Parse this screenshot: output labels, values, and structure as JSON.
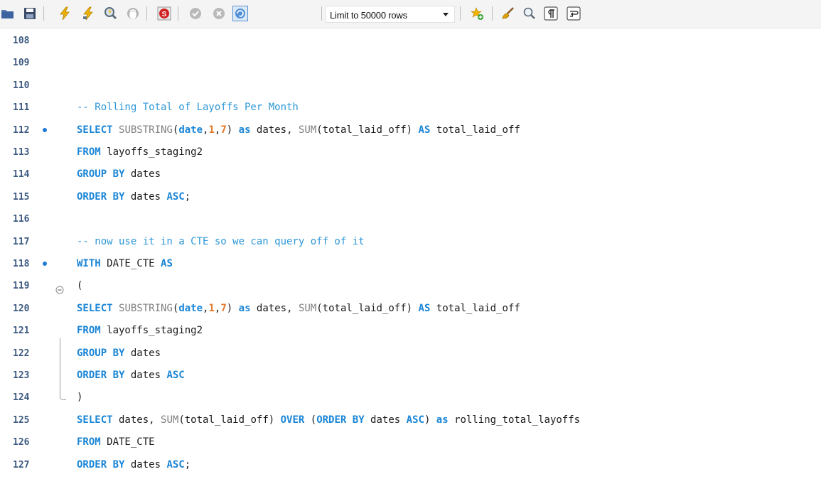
{
  "toolbar": {
    "buttons": [
      {
        "name": "open-folder-icon",
        "color": "#4a6fa5"
      },
      {
        "name": "save-icon",
        "color": "#3a4a66"
      },
      {
        "name": "execute-lightning-icon",
        "color": "#f0b400"
      },
      {
        "name": "execute-current-lightning-icon",
        "color": "#f0b400"
      },
      {
        "name": "explain-magnifier-icon",
        "color": "#6a7a8a"
      },
      {
        "name": "stop-icon",
        "color": "#9a9a9a"
      },
      {
        "name": "stop-on-error-icon",
        "color": "#d02020"
      },
      {
        "name": "commit-icon",
        "color": "#9a9a9a"
      },
      {
        "name": "rollback-icon",
        "color": "#9a9a9a"
      },
      {
        "name": "autocommit-icon",
        "color": "#2f78c8"
      },
      {
        "name": "add-snippet-star-icon",
        "color": "#f0b400"
      },
      {
        "name": "beautify-brush-icon",
        "color": "#e0a000"
      },
      {
        "name": "find-magnifier-icon",
        "color": "#6a7a8a"
      },
      {
        "name": "invisible-chars-icon",
        "color": "#333333"
      },
      {
        "name": "word-wrap-icon",
        "color": "#333333"
      }
    ],
    "limit_label": "Limit to 50000 rows"
  },
  "editor": {
    "lines": [
      {
        "n": "108",
        "bp": false,
        "tokens": []
      },
      {
        "n": "109",
        "bp": false,
        "tokens": []
      },
      {
        "n": "110",
        "bp": false,
        "tokens": []
      },
      {
        "n": "111",
        "bp": false,
        "tokens": [
          {
            "t": "cm",
            "v": "-- Rolling Total of Layoffs Per Month"
          }
        ]
      },
      {
        "n": "112",
        "bp": true,
        "tokens": [
          {
            "t": "kw",
            "v": "SELECT"
          },
          {
            "t": "tx",
            "v": " "
          },
          {
            "t": "fn",
            "v": "SUBSTRING"
          },
          {
            "t": "tx",
            "v": "("
          },
          {
            "t": "kw",
            "v": "date"
          },
          {
            "t": "tx",
            "v": ","
          },
          {
            "t": "num",
            "v": "1"
          },
          {
            "t": "tx",
            "v": ","
          },
          {
            "t": "num",
            "v": "7"
          },
          {
            "t": "tx",
            "v": ") "
          },
          {
            "t": "kw",
            "v": "as"
          },
          {
            "t": "tx",
            "v": " dates, "
          },
          {
            "t": "fn",
            "v": "SUM"
          },
          {
            "t": "tx",
            "v": "(total_laid_off) "
          },
          {
            "t": "kw",
            "v": "AS"
          },
          {
            "t": "tx",
            "v": " total_laid_off"
          }
        ]
      },
      {
        "n": "113",
        "bp": false,
        "tokens": [
          {
            "t": "kw",
            "v": "FROM"
          },
          {
            "t": "tx",
            "v": " layoffs_staging2"
          }
        ]
      },
      {
        "n": "114",
        "bp": false,
        "tokens": [
          {
            "t": "kw",
            "v": "GROUP BY"
          },
          {
            "t": "tx",
            "v": " dates"
          }
        ]
      },
      {
        "n": "115",
        "bp": false,
        "tokens": [
          {
            "t": "kw",
            "v": "ORDER BY"
          },
          {
            "t": "tx",
            "v": " dates "
          },
          {
            "t": "kw",
            "v": "ASC"
          },
          {
            "t": "tx",
            "v": ";"
          }
        ]
      },
      {
        "n": "116",
        "bp": false,
        "tokens": []
      },
      {
        "n": "117",
        "bp": false,
        "tokens": [
          {
            "t": "cm",
            "v": "-- now use it in a CTE so we can query off of it"
          }
        ]
      },
      {
        "n": "118",
        "bp": true,
        "tokens": [
          {
            "t": "kw",
            "v": "WITH"
          },
          {
            "t": "tx",
            "v": " DATE_CTE "
          },
          {
            "t": "kw",
            "v": "AS"
          }
        ]
      },
      {
        "n": "119",
        "bp": false,
        "fold": true,
        "tokens": [
          {
            "t": "tx",
            "v": "("
          }
        ]
      },
      {
        "n": "120",
        "bp": false,
        "tokens": [
          {
            "t": "kw",
            "v": "SELECT"
          },
          {
            "t": "tx",
            "v": " "
          },
          {
            "t": "fn",
            "v": "SUBSTRING"
          },
          {
            "t": "tx",
            "v": "("
          },
          {
            "t": "kw",
            "v": "date"
          },
          {
            "t": "tx",
            "v": ","
          },
          {
            "t": "num",
            "v": "1"
          },
          {
            "t": "tx",
            "v": ","
          },
          {
            "t": "num",
            "v": "7"
          },
          {
            "t": "tx",
            "v": ") "
          },
          {
            "t": "kw",
            "v": "as"
          },
          {
            "t": "tx",
            "v": " dates, "
          },
          {
            "t": "fn",
            "v": "SUM"
          },
          {
            "t": "tx",
            "v": "(total_laid_off) "
          },
          {
            "t": "kw",
            "v": "AS"
          },
          {
            "t": "tx",
            "v": " total_laid_off"
          }
        ]
      },
      {
        "n": "121",
        "bp": false,
        "tokens": [
          {
            "t": "kw",
            "v": "FROM"
          },
          {
            "t": "tx",
            "v": " layoffs_staging2"
          }
        ]
      },
      {
        "n": "122",
        "bp": false,
        "tokens": [
          {
            "t": "kw",
            "v": "GROUP BY"
          },
          {
            "t": "tx",
            "v": " dates"
          }
        ]
      },
      {
        "n": "123",
        "bp": false,
        "tokens": [
          {
            "t": "kw",
            "v": "ORDER BY"
          },
          {
            "t": "tx",
            "v": " dates "
          },
          {
            "t": "kw",
            "v": "ASC"
          }
        ]
      },
      {
        "n": "124",
        "bp": false,
        "tokens": [
          {
            "t": "tx",
            "v": ")"
          }
        ]
      },
      {
        "n": "125",
        "bp": false,
        "tokens": [
          {
            "t": "kw",
            "v": "SELECT"
          },
          {
            "t": "tx",
            "v": " dates, "
          },
          {
            "t": "fn",
            "v": "SUM"
          },
          {
            "t": "tx",
            "v": "(total_laid_off) "
          },
          {
            "t": "kw",
            "v": "OVER"
          },
          {
            "t": "tx",
            "v": " ("
          },
          {
            "t": "kw",
            "v": "ORDER BY"
          },
          {
            "t": "tx",
            "v": " dates "
          },
          {
            "t": "kw",
            "v": "ASC"
          },
          {
            "t": "tx",
            "v": ") "
          },
          {
            "t": "kw",
            "v": "as"
          },
          {
            "t": "tx",
            "v": " rolling_total_layoffs"
          }
        ]
      },
      {
        "n": "126",
        "bp": false,
        "tokens": [
          {
            "t": "kw",
            "v": "FROM"
          },
          {
            "t": "tx",
            "v": " DATE_CTE"
          }
        ]
      },
      {
        "n": "127",
        "bp": false,
        "tokens": [
          {
            "t": "kw",
            "v": "ORDER BY"
          },
          {
            "t": "tx",
            "v": " dates "
          },
          {
            "t": "kw",
            "v": "ASC"
          },
          {
            "t": "tx",
            "v": ";"
          }
        ]
      }
    ]
  }
}
